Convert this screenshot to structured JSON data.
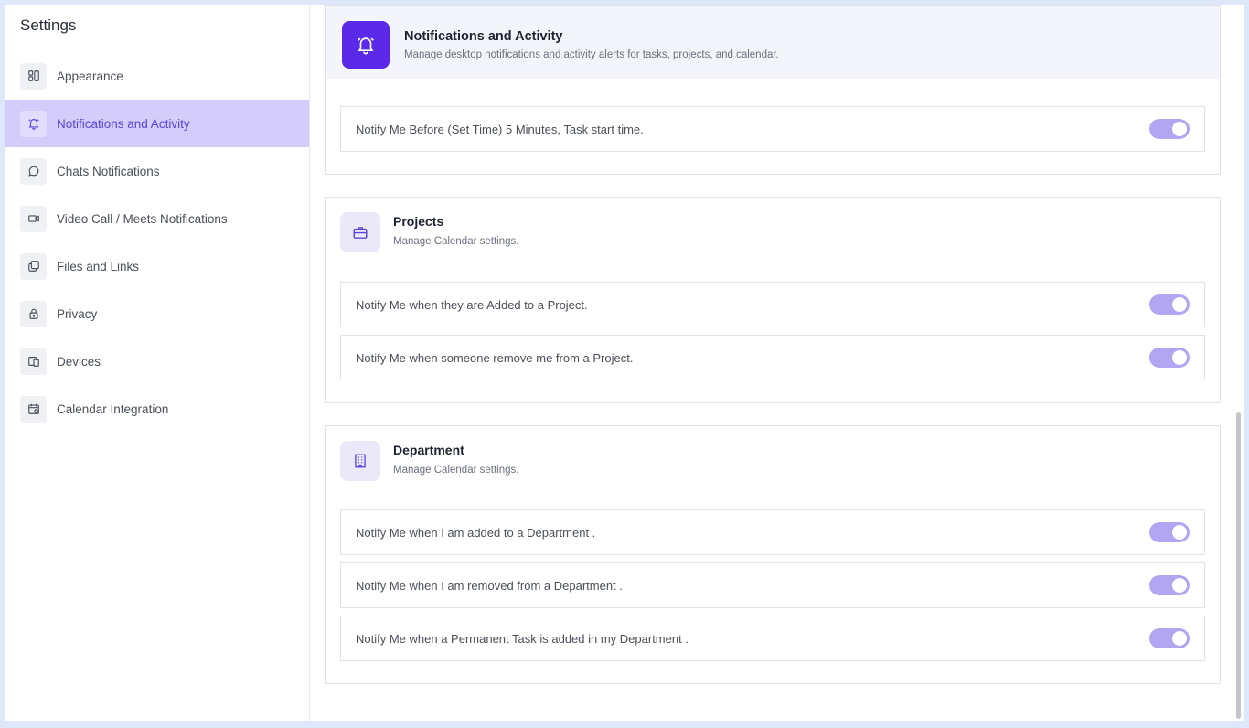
{
  "sidebar": {
    "title": "Settings",
    "items": [
      {
        "label": "Appearance",
        "icon": "layout-icon"
      },
      {
        "label": "Notifications and Activity",
        "icon": "bell-icon",
        "active": true
      },
      {
        "label": "Chats Notifications",
        "icon": "chat-bubble-icon"
      },
      {
        "label": "Video Call / Meets Notifications",
        "icon": "video-camera-icon"
      },
      {
        "label": "Files and Links",
        "icon": "copy-files-icon"
      },
      {
        "label": "Privacy",
        "icon": "lock-icon"
      },
      {
        "label": "Devices",
        "icon": "devices-icon"
      },
      {
        "label": "Calendar Integration",
        "icon": "calendar-icon"
      }
    ]
  },
  "header": {
    "title": "Notifications and Activity",
    "subtitle": "Manage desktop notifications and activity alerts for tasks, projects, and calendar.",
    "icon": "bell-icon"
  },
  "tasks_section": {
    "rows": [
      {
        "label": "Notify Me Before (Set Time) 5 Minutes, Task start time.",
        "enabled": true
      }
    ]
  },
  "projects_section": {
    "title": "Projects",
    "subtitle": "Manage Calendar settings.",
    "icon": "briefcase-icon",
    "rows": [
      {
        "label": "Notify Me when they are Added to a Project.",
        "enabled": true
      },
      {
        "label": "Notify Me when someone remove me from a Project.",
        "enabled": true
      }
    ]
  },
  "department_section": {
    "title": "Department",
    "subtitle": "Manage Calendar settings.",
    "icon": "building-icon",
    "rows": [
      {
        "label": "Notify Me when I am added to a Department .",
        "enabled": true
      },
      {
        "label": "Notify Me when I am removed from a Department .",
        "enabled": true
      },
      {
        "label": "Notify Me when a Permanent Task is added in my Department .",
        "enabled": true
      }
    ]
  },
  "colors": {
    "accent": "#5b2ae8",
    "active_nav_bg": "#d4cdfb",
    "toggle_on": "#b2a5f2",
    "page_bg": "#dde8fb"
  }
}
